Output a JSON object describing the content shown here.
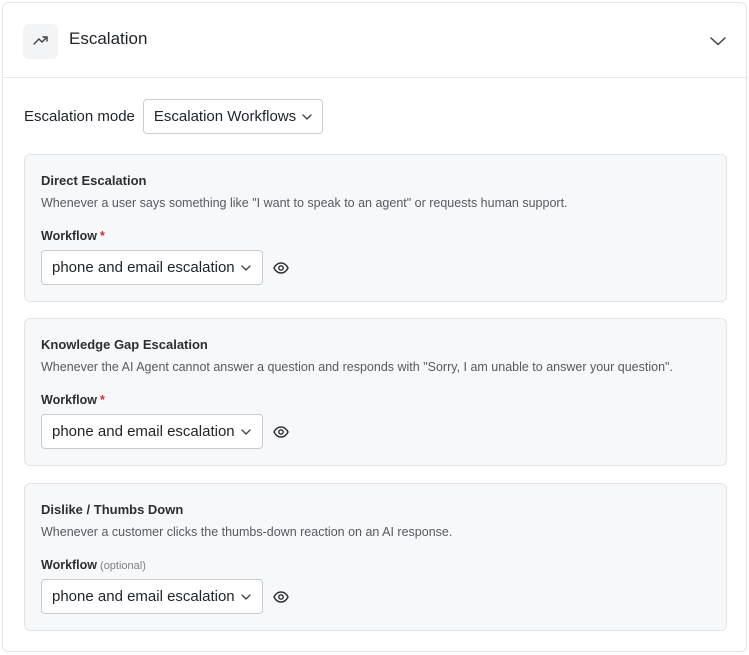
{
  "header": {
    "title": "Escalation",
    "icon": "trending-up-icon",
    "collapse_icon": "chevron-down-icon"
  },
  "mode": {
    "label": "Escalation mode",
    "value": "Escalation Workflows"
  },
  "cards": [
    {
      "title": "Direct Escalation",
      "description": "Whenever a user says something like \"I want to speak to an agent\" or requests human support.",
      "workflow_label": "Workflow",
      "required_mark": "*",
      "optional_text": "",
      "workflow_value": "phone and email escalation"
    },
    {
      "title": "Knowledge Gap Escalation",
      "description": "Whenever the AI Agent cannot answer a question and responds with \"Sorry, I am unable to answer your question\".",
      "workflow_label": "Workflow",
      "required_mark": "*",
      "optional_text": "",
      "workflow_value": "phone and email escalation"
    },
    {
      "title": "Dislike / Thumbs Down",
      "description": "Whenever a customer clicks the thumbs-down reaction on an AI response.",
      "workflow_label": "Workflow",
      "required_mark": "",
      "optional_text": "(optional)",
      "workflow_value": "phone and email escalation"
    }
  ],
  "colors": {
    "required": "#d12e2e",
    "card_bg": "#f7f8fa",
    "border": "#e3e5e8"
  }
}
